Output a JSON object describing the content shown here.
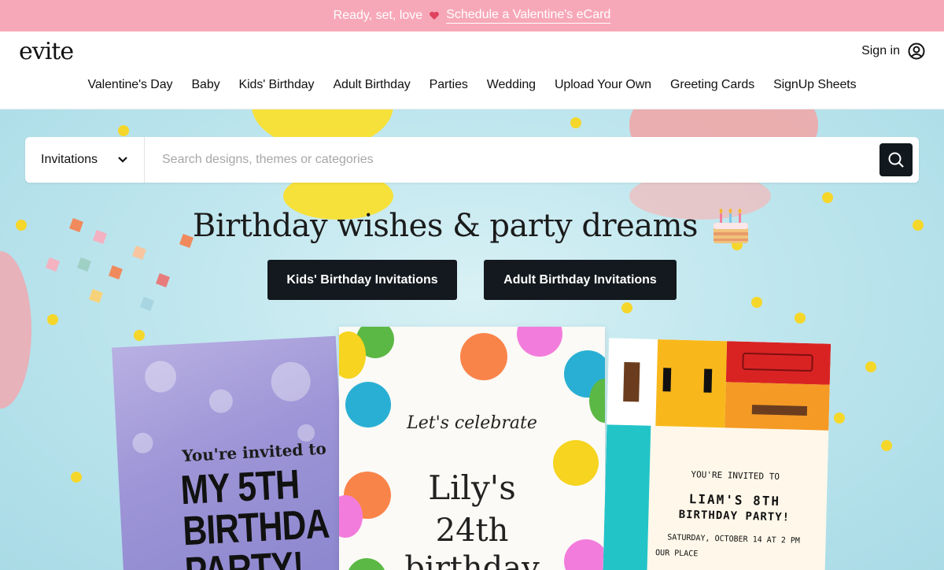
{
  "promo": {
    "text": "Ready, set, love",
    "link": "Schedule a Valentine's eCard"
  },
  "header": {
    "logo": "evite",
    "signin": "Sign in",
    "nav": [
      "Valentine's Day",
      "Baby",
      "Kids' Birthday",
      "Adult Birthday",
      "Parties",
      "Wedding",
      "Upload Your Own",
      "Greeting Cards",
      "SignUp Sheets"
    ]
  },
  "search": {
    "category": "Invitations",
    "placeholder": "Search designs, themes or categories"
  },
  "hero": {
    "headline": "Birthday wishes & party dreams",
    "cta_kids": "Kids' Birthday Invitations",
    "cta_adult": "Adult Birthday Invitations"
  },
  "cards": {
    "left": {
      "line1": "You're invited to",
      "line2": "MY 5TH",
      "line3": "BIRTHDA",
      "line4": "PARTY!"
    },
    "middle": {
      "script": "Let's celebrate",
      "name": "Lily's",
      "age": "24th",
      "bday": "birthday"
    },
    "right": {
      "line1": "YOU'RE INVITED TO",
      "line2": "LIAM'S 8TH",
      "line3": "BIRTHDAY PARTY!",
      "line4": "SATURDAY, OCTOBER 14 AT 2 PM",
      "line5": "OUR PLACE"
    }
  },
  "colors": {
    "promo_bg": "#f7a8b8",
    "cta_bg": "#13191e",
    "hero_bg": "#bfe6ee"
  }
}
